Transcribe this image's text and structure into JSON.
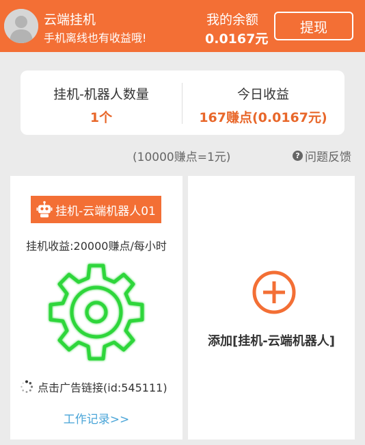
{
  "header": {
    "title": "云端挂机",
    "subtitle": "手机离线也有收益哦!",
    "balance_label": "我的余额",
    "balance_value": "0.0167元",
    "withdraw_label": "提现"
  },
  "stats": {
    "robot_count_label": "挂机-机器人数量",
    "robot_count_value": "1个",
    "today_earnings_label": "今日收益",
    "today_earnings_value": "167赚点(0.0167元)"
  },
  "rate_note": "(10000赚点=1元)",
  "feedback_label": "问题反馈",
  "robot_card": {
    "name": "挂机-云端机器人01",
    "rate": "挂机收益:20000赚点/每小时",
    "ad_link": "点击广告链接(id:545111)",
    "work_record": "工作记录>>"
  },
  "add_card": {
    "label": "添加[挂机-云端机器人]"
  },
  "colors": {
    "accent": "#f36f35",
    "highlight": "#e8672a",
    "link": "#4aa5d8",
    "gear": "#2ed63a"
  },
  "icons": [
    "avatar",
    "question-icon",
    "robot-icon",
    "gear-icon",
    "loading-spinner-icon",
    "plus-circle-icon"
  ]
}
